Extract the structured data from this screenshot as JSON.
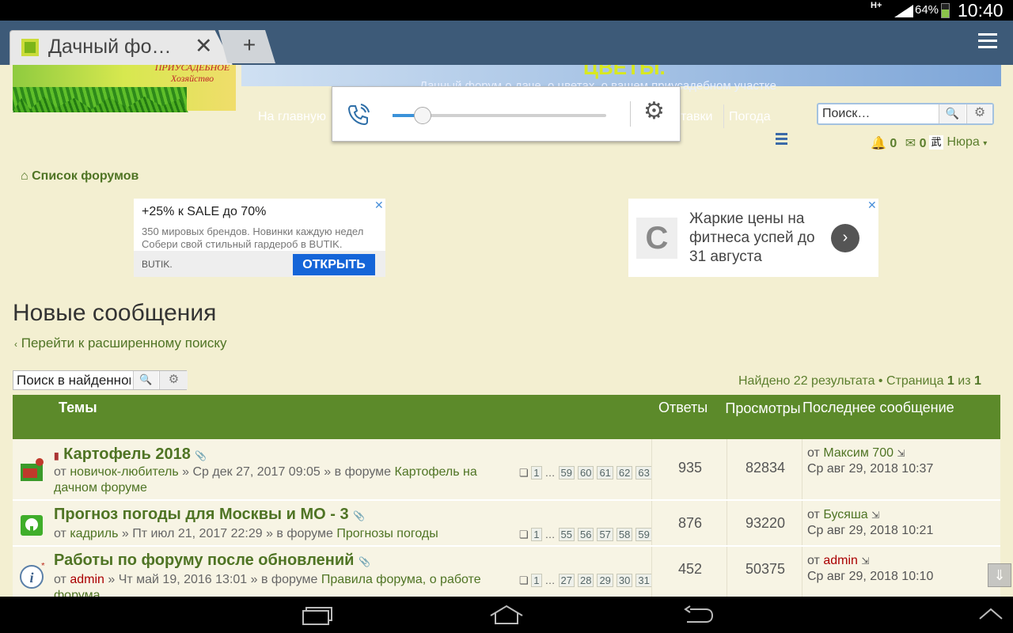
{
  "status": {
    "network": "H+",
    "battery": "64%",
    "battery_level": 0.64,
    "time": "10:40"
  },
  "browser": {
    "tab_title": "Дачный фо…",
    "close_glyph": "✕",
    "new_tab_glyph": "+"
  },
  "header": {
    "logo_text": "ПРИУСАДЕБНОЕ Хозяйство",
    "banner_title": "ЦВЕТЫ.",
    "banner_subtitle": "Дачный форум о даче, о цветах, о вашем приусадебном участке",
    "nav": [
      "На главную",
      "тавки",
      "Погода"
    ],
    "search_placeholder": "Поиск…",
    "notifications": "0",
    "messages": "0",
    "username": "Нюра"
  },
  "volume": {
    "level": 0.14
  },
  "breadcrumb": "Список форумов",
  "ads": {
    "ad1": {
      "headline": "+25% к SALE до 70%",
      "body": "350 мировых брендов. Новинки каждую недел",
      "body2": "Собери свой стильный гардероб в BUTIK.",
      "brand": "BUTIK.",
      "cta": "ОТКРЫТЬ"
    },
    "ad2": {
      "text": "Жаркие цены на фитнеса успей до 31 августа"
    }
  },
  "page": {
    "title": "Новые сообщения",
    "advanced_search": "Перейти к расширенному поиску",
    "results_search_placeholder": "Поиск в найденном",
    "found": "Найдено 22 результата • Страница",
    "page_current": "1",
    "page_of": "из",
    "page_total": "1"
  },
  "table": {
    "headers": {
      "topics": "Темы",
      "replies": "Ответы",
      "views": "Просмотры",
      "last": "Последнее сообщение"
    },
    "rows": [
      {
        "title": "Картофель 2018",
        "author": "новичок-любитель",
        "date": "Ср дек 27, 2017 09:05",
        "forum": "Картофель на дачном форуме",
        "pages": [
          "1",
          "…",
          "59",
          "60",
          "61",
          "62",
          "63"
        ],
        "replies": "935",
        "views": "82834",
        "last_by": "Максим 700",
        "last_date": "Ср авг 29, 2018 10:37"
      },
      {
        "title": "Прогноз погоды для Москвы и МО - 3",
        "author": "кадриль",
        "date": "Пт июл 21, 2017 22:29",
        "forum": "Прогнозы погоды",
        "pages": [
          "1",
          "…",
          "55",
          "56",
          "57",
          "58",
          "59"
        ],
        "replies": "876",
        "views": "93220",
        "last_by": "Бусяша",
        "last_date": "Ср авг 29, 2018 10:21"
      },
      {
        "title": "Работы по форуму после обновлений",
        "author": "admin",
        "date": "Чт май 19, 2016 13:01",
        "forum": "Правила форума, о работе форума",
        "pages": [
          "1",
          "…",
          "27",
          "28",
          "29",
          "30",
          "31"
        ],
        "replies": "452",
        "views": "50375",
        "last_by": "admin",
        "last_date": "Ср авг 29, 2018 10:10"
      }
    ],
    "prefix_from": "от",
    "prefix_in": "» в форуме"
  },
  "icons": [
    "phone-volume-icon",
    "gear-icon",
    "search-icon",
    "bell-icon",
    "envelope-icon",
    "home-icon",
    "recent-apps-icon",
    "back-icon"
  ]
}
